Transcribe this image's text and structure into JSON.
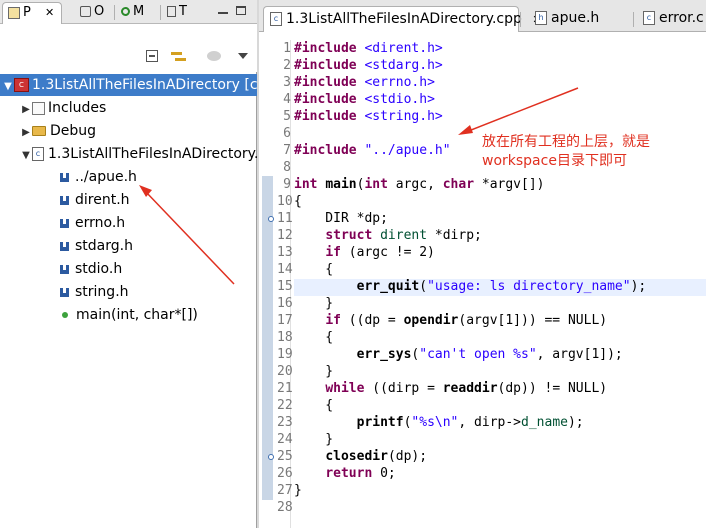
{
  "left_panel": {
    "tabs": [
      {
        "label": "P",
        "close": "✕"
      },
      {
        "label": "O"
      },
      {
        "label": "M"
      },
      {
        "label": "T"
      }
    ],
    "tree": [
      {
        "label": "1.3ListAllTheFilesInADirectory [c",
        "level": 0,
        "expanded": true,
        "icon": "project-icon",
        "selected": true
      },
      {
        "label": "Includes",
        "level": 1,
        "expanded": false,
        "icon": "includes-icon"
      },
      {
        "label": "Debug",
        "level": 1,
        "expanded": false,
        "icon": "folder-icon"
      },
      {
        "label": "1.3ListAllTheFilesInADirectory.",
        "level": 1,
        "expanded": true,
        "icon": "cpp-file-icon"
      },
      {
        "label": "../apue.h",
        "level": 2,
        "icon": "header-include-icon"
      },
      {
        "label": "dirent.h",
        "level": 2,
        "icon": "header-include-icon"
      },
      {
        "label": "errno.h",
        "level": 2,
        "icon": "header-include-icon"
      },
      {
        "label": "stdarg.h",
        "level": 2,
        "icon": "header-include-icon"
      },
      {
        "label": "stdio.h",
        "level": 2,
        "icon": "header-include-icon"
      },
      {
        "label": "string.h",
        "level": 2,
        "icon": "header-include-icon"
      },
      {
        "label": "main(int, char*[])",
        "level": 2,
        "icon": "function-icon"
      }
    ]
  },
  "editor": {
    "tabs": [
      {
        "label": "1.3ListAllTheFilesInADirectory.cpp",
        "close": "✕",
        "active": true
      },
      {
        "label": "apue.h"
      },
      {
        "label": "error.c"
      }
    ],
    "line_numbers": [
      "1",
      "2",
      "3",
      "4",
      "5",
      "6",
      "7",
      "8",
      "9",
      "10",
      "11",
      "12",
      "13",
      "14",
      "15",
      "16",
      "17",
      "18",
      "19",
      "20",
      "21",
      "22",
      "23",
      "24",
      "25",
      "26",
      "27",
      "28"
    ],
    "tokens": {
      "include": "#include",
      "h_dirent": "<dirent.h>",
      "h_stdarg": "<stdarg.h>",
      "h_errno": "<errno.h>",
      "h_stdio": "<stdio.h>",
      "h_string": "<string.h>",
      "h_apue": "\"../apue.h\"",
      "int": "int",
      "char": "char",
      "struct": "struct",
      "if": "if",
      "while": "while",
      "return": "return",
      "main": "main",
      "err_quit": "err_quit",
      "err_sys": "err_sys",
      "opendir": "opendir",
      "readdir": "readdir",
      "printf": "printf",
      "closedir": "closedir",
      "dirent": "dirent",
      "d_name": "d_name",
      "s_usage": "\"usage: ls directory_name\"",
      "s_cant": "\"can't open %s\"",
      "s_fmt": "\"%s\\n\"",
      "l9_params": " argc, ",
      "l9_end": " *argv[])",
      "l10": "{",
      "l11": "    DIR *dp;",
      "l12_a": "    ",
      "l12_b": " ",
      "l12_c": " *dirp;",
      "l13_a": "    ",
      "l13_b": " (argc != 2)",
      "l14": "    {",
      "l15_a": "        ",
      "l15_b": "(",
      "l15_c": ");",
      "l16": "    }",
      "l17_a": "    ",
      "l17_b": " ((dp = ",
      "l17_c": "(argv[1])) == NULL)",
      "l18": "    {",
      "l19_a": "        ",
      "l19_b": "(",
      "l19_c": ", argv[1]);",
      "l20": "    }",
      "l21_a": "    ",
      "l21_b": " ((dirp = ",
      "l21_c": "(dp)) != NULL)",
      "l22": "    {",
      "l23_a": "        ",
      "l23_b": "(",
      "l23_c": ", dirp->",
      "l23_d": ");",
      "l24": "    }",
      "l25_a": "    ",
      "l25_b": "(dp);",
      "l26_a": "    ",
      "l26_b": " 0;",
      "l27": "}"
    }
  },
  "annotation": {
    "line1": "放在所有工程的上层，就是",
    "line2": "workspace目录下即可"
  }
}
